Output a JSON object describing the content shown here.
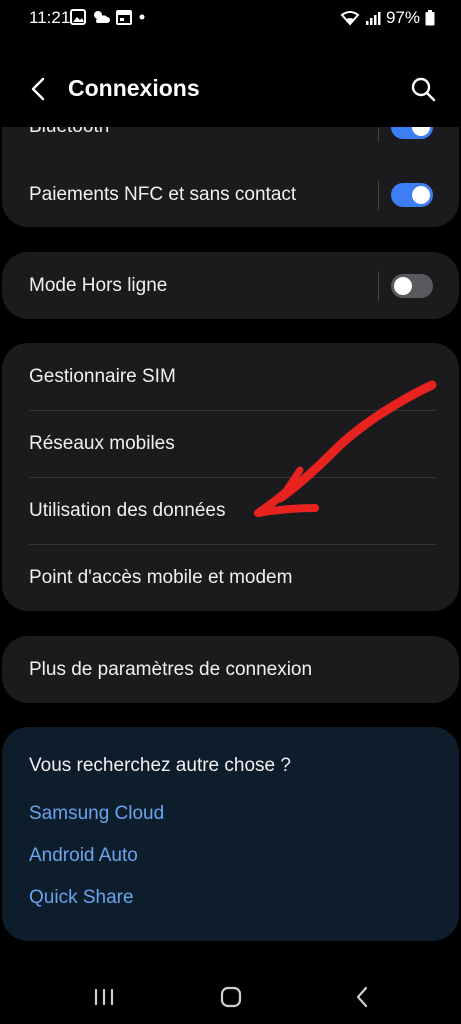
{
  "status_bar": {
    "time": "11:21",
    "notification_icons": [
      "image-icon",
      "weather-icon",
      "calendar-icon",
      "dot-icon"
    ],
    "battery_percent": "97%",
    "system_icons": [
      "wifi-icon",
      "signal-icon",
      "battery-icon"
    ]
  },
  "header": {
    "title": "Connexions",
    "back_icon": "chevron-left-icon",
    "search_icon": "search-icon"
  },
  "card_wireless": {
    "rows": [
      {
        "label": "Bluetooth",
        "toggle": "on"
      },
      {
        "label": "Paiements NFC et sans contact",
        "toggle": "on"
      }
    ]
  },
  "card_airplane": {
    "rows": [
      {
        "label": "Mode Hors ligne",
        "toggle": "off"
      }
    ]
  },
  "card_network": {
    "rows": [
      {
        "label": "Gestionnaire SIM"
      },
      {
        "label": "Réseaux mobiles"
      },
      {
        "label": "Utilisation des données"
      },
      {
        "label": "Point d'accès mobile et modem"
      }
    ]
  },
  "card_more": {
    "rows": [
      {
        "label": "Plus de paramètres de connexion"
      }
    ]
  },
  "suggestions": {
    "title": "Vous recherchez autre chose ?",
    "links": [
      "Samsung Cloud",
      "Android Auto",
      "Quick Share"
    ]
  },
  "nav_bar": {
    "buttons": [
      "recent-apps-icon",
      "home-icon",
      "back-icon"
    ]
  },
  "colors": {
    "accent": "#3e7ef5",
    "link": "#6aa4ee",
    "card": "#1b1b1d",
    "suggest_card": "#0e1d2c",
    "annotation": "#e8231f"
  }
}
